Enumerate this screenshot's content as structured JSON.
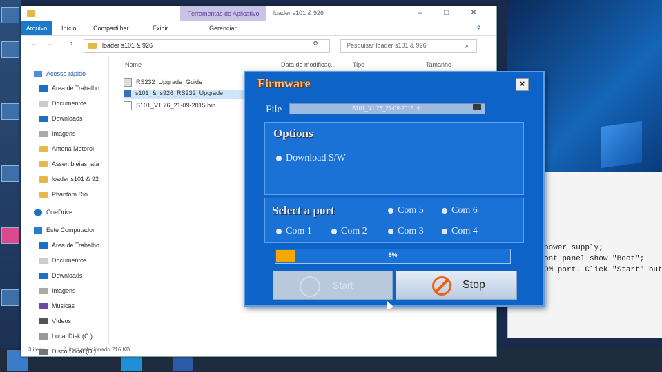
{
  "explorer": {
    "window_title": "loader s101 & 926",
    "tools_tab": "Ferramentas de Aplicativo",
    "ribbon": {
      "file": "Arquivo",
      "home": "Início",
      "share": "Compartilhar",
      "view": "Exibir",
      "manage": "Gerenciar"
    },
    "address": "loader s101 & 926",
    "search_placeholder": "Pesquisar loader s101 & 926",
    "nav": {
      "quick_access": "Acesso rápido",
      "items": [
        "Área de Trabalho",
        "Documentos",
        "Downloads",
        "Imagens",
        "Antena Motoroi",
        "Assembleias_ata",
        "loader s101 & 92",
        "Phantom Rio"
      ],
      "onedrive": "OneDrive",
      "this_pc": "Este Computador",
      "pc_items": [
        "Área de Trabalho",
        "Documentos",
        "Downloads",
        "Imagens",
        "Músicas",
        "Vídeos",
        "Local Disk (C:)",
        "Disco Local (D:)"
      ]
    },
    "columns": {
      "name": "Nome",
      "date": "Data de modificaç...",
      "type": "Tipo",
      "size": "Tamanho"
    },
    "files": [
      "RS232_Upgrade_Guide",
      "s101_&_s926_RS232_Upgrade",
      "S101_V1.76_21-09-2015.bin"
    ],
    "status": {
      "items": "3 itens",
      "selected": "1 item selecionado  716 KB"
    }
  },
  "firmware": {
    "title": "Firmware",
    "close": "×",
    "file_label": "File",
    "file_value": "S101_V1.76_21-09-2015.bin",
    "options_title": "Options",
    "option_download": "Download S/W",
    "port_title": "Select a port",
    "ports": [
      "Com 5",
      "Com 6",
      "Com 1",
      "Com 2",
      "Com 3",
      "Com 4"
    ],
    "progress_percent": 8,
    "progress_text": "8%",
    "start_label": "Start",
    "stop_label": "Stop"
  },
  "notepad_text": "power supply;\nont panel show \"Boot\";\nOM port. Click \"Start\" but"
}
